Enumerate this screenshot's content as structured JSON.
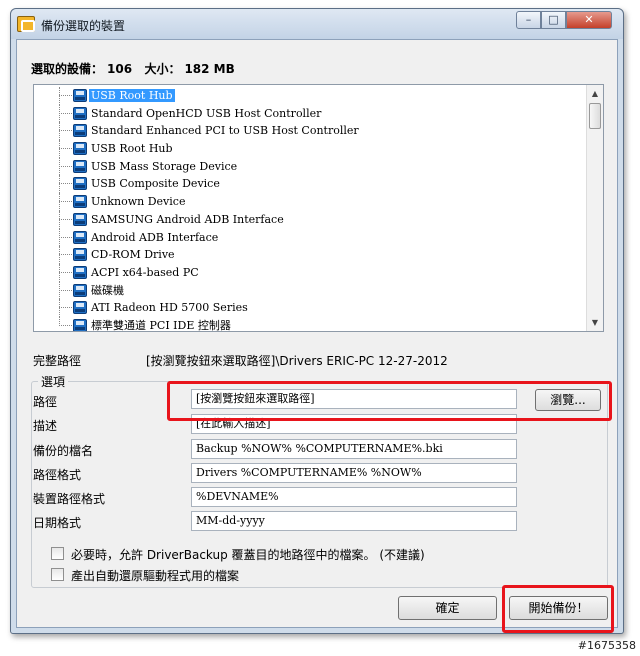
{
  "window": {
    "title": "備份選取的裝置",
    "controls": {
      "minimize": "–",
      "maximize": "□",
      "close": "✕"
    }
  },
  "summary": {
    "selected_label": "選取的設備：",
    "selected_count": "106",
    "size_label": "大小：",
    "size_value": "182 MB"
  },
  "device_icon": "device-icon",
  "devices": [
    {
      "label": "USB Root Hub",
      "selected": true
    },
    {
      "label": "Standard OpenHCD USB Host Controller"
    },
    {
      "label": "Standard Enhanced PCI to USB Host Controller"
    },
    {
      "label": "USB Root Hub"
    },
    {
      "label": "USB Mass Storage Device"
    },
    {
      "label": "USB Composite Device"
    },
    {
      "label": "Unknown Device"
    },
    {
      "label": "SAMSUNG Android ADB Interface"
    },
    {
      "label": "Android ADB Interface"
    },
    {
      "label": "CD-ROM Drive"
    },
    {
      "label": "ACPI x64-based PC"
    },
    {
      "label": "磁碟機"
    },
    {
      "label": "ATI Radeon HD 5700 Series"
    },
    {
      "label": "標準雙通道 PCI IDE 控制器"
    }
  ],
  "full_path": {
    "label": "完整路徑",
    "value": "[按瀏覽按鈕來選取路徑]\\Drivers ERIC-PC 12-27-2012"
  },
  "options": {
    "group_title": "選項",
    "path_label": "路徑",
    "path_value": "[按瀏覽按鈕來選取路徑]",
    "browse_label": "瀏覽...",
    "description_label": "描述",
    "description_value": "[在此輸入描述]",
    "filename_label": "備份的檔名",
    "filename_value": "Backup %NOW% %COMPUTERNAME%.bki",
    "path_format_label": "路徑格式",
    "path_format_value": "Drivers %COMPUTERNAME% %NOW%",
    "device_path_format_label": "裝置路徑格式",
    "device_path_format_value": "%DEVNAME%",
    "date_format_label": "日期格式",
    "date_format_value": "MM-dd-yyyy"
  },
  "checkboxes": [
    {
      "label": "必要時，允許 DriverBackup 覆蓋目的地路徑中的檔案。 (不建議)"
    },
    {
      "label": "產出自動還原驅動程式用的檔案"
    }
  ],
  "buttons": {
    "ok": "確定",
    "start": "開始備份！"
  },
  "watermark": "#1675358",
  "colors": {
    "highlight": "#e8141b",
    "selection": "#3399ff"
  }
}
